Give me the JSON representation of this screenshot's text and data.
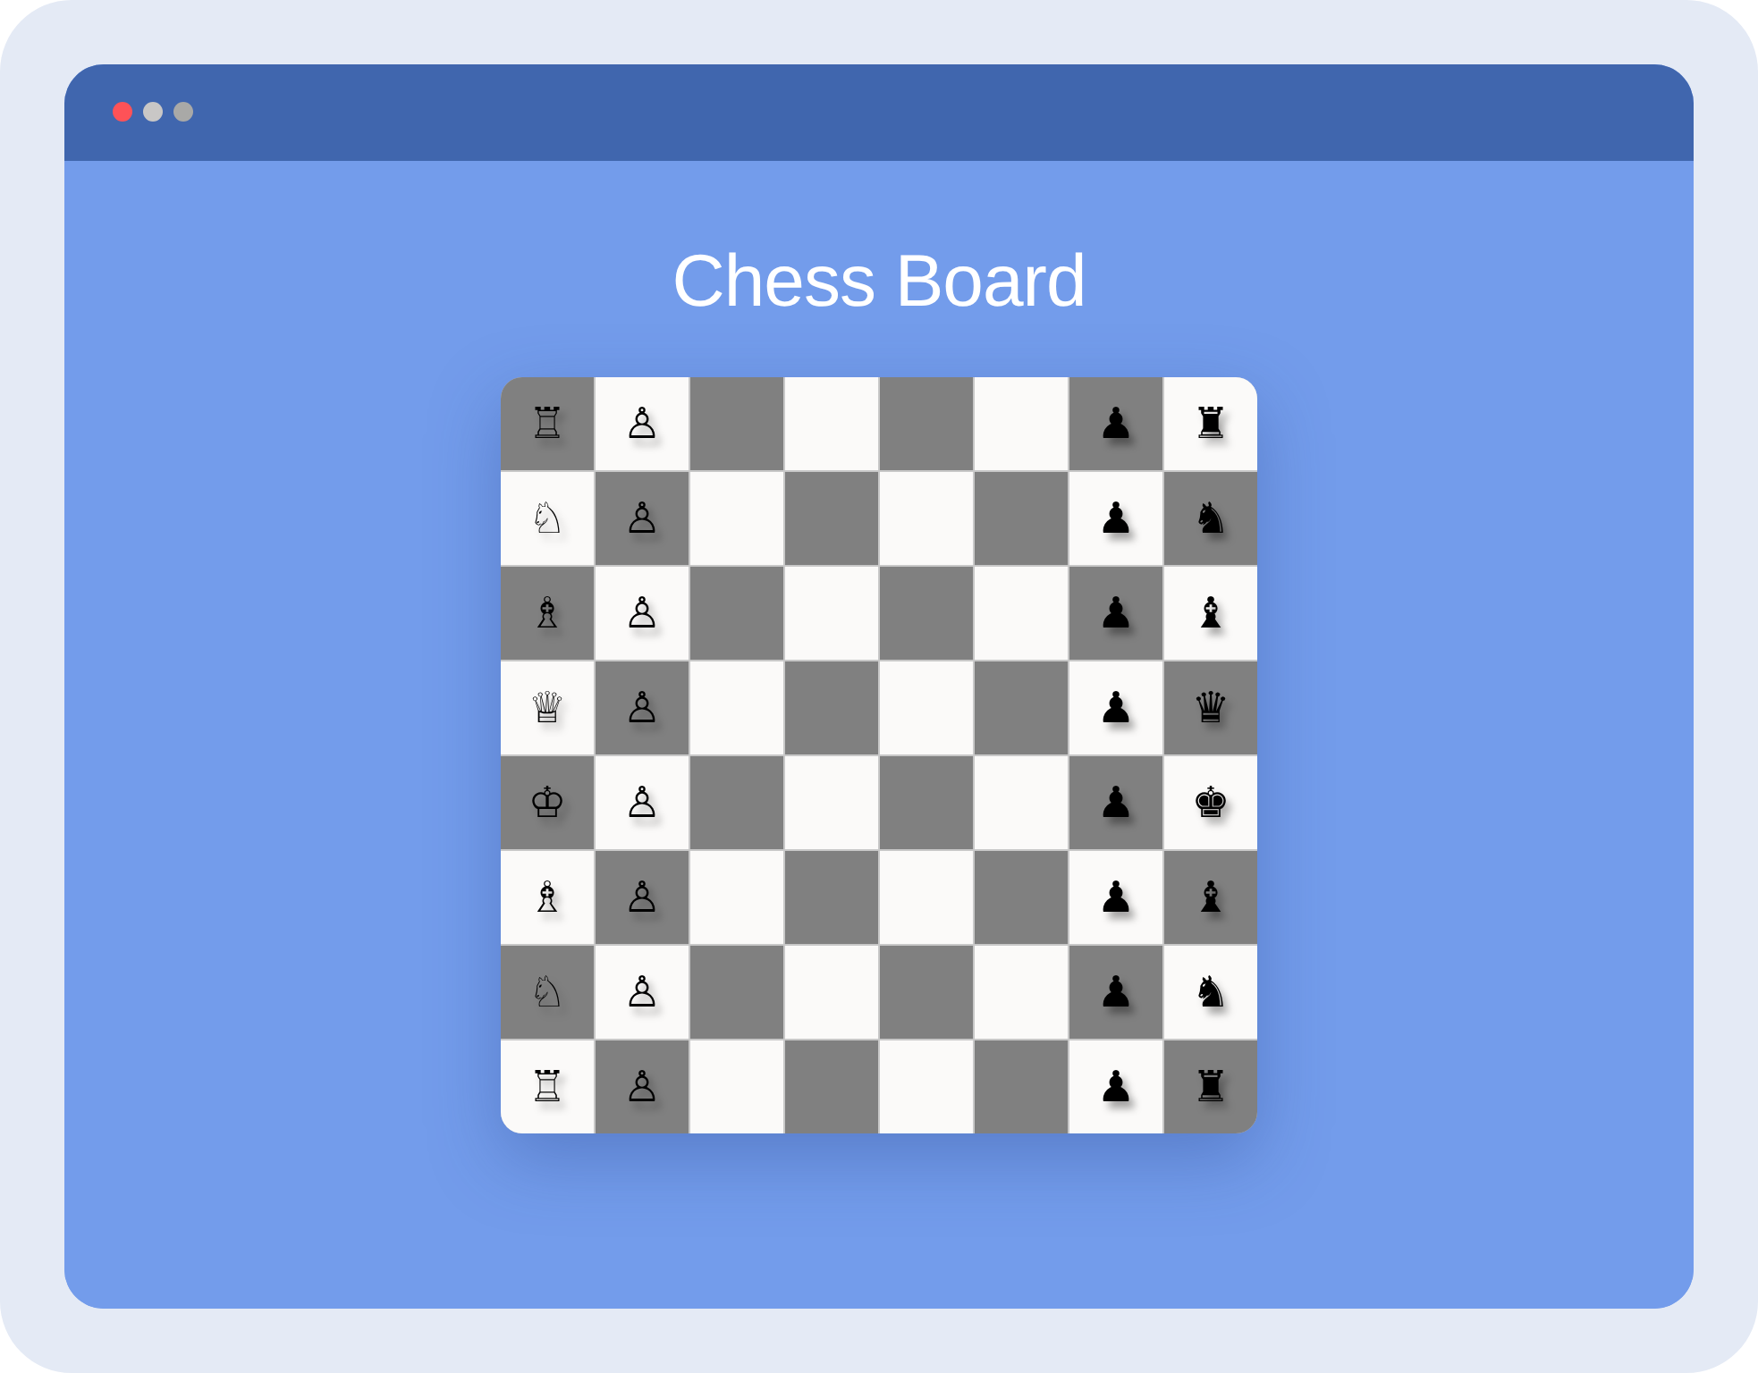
{
  "window": {
    "controls": [
      {
        "color": "#fe5257"
      },
      {
        "color": "#c9c7c6"
      },
      {
        "color": "#a9a9a7"
      }
    ]
  },
  "title": "Chess Board",
  "board": {
    "rows": [
      {
        "squares": [
          {
            "kind": "dark",
            "piece": "♖"
          },
          {
            "kind": "light",
            "piece": "♙"
          },
          {
            "kind": "dark"
          },
          {
            "kind": "light"
          },
          {
            "kind": "dark"
          },
          {
            "kind": "light"
          },
          {
            "kind": "dark",
            "piece": "♟"
          },
          {
            "kind": "light",
            "piece": "♜"
          }
        ]
      },
      {
        "squares": [
          {
            "kind": "light",
            "piece": "♘"
          },
          {
            "kind": "dark",
            "piece": "♙"
          },
          {
            "kind": "light"
          },
          {
            "kind": "dark"
          },
          {
            "kind": "light"
          },
          {
            "kind": "dark"
          },
          {
            "kind": "light",
            "piece": "♟"
          },
          {
            "kind": "dark",
            "piece": "♞"
          }
        ]
      },
      {
        "squares": [
          {
            "kind": "dark",
            "piece": "♗"
          },
          {
            "kind": "light",
            "piece": "♙"
          },
          {
            "kind": "dark"
          },
          {
            "kind": "light"
          },
          {
            "kind": "dark"
          },
          {
            "kind": "light"
          },
          {
            "kind": "dark",
            "piece": "♟"
          },
          {
            "kind": "light",
            "piece": "♝"
          }
        ]
      },
      {
        "squares": [
          {
            "kind": "light",
            "piece": "♕"
          },
          {
            "kind": "dark",
            "piece": "♙"
          },
          {
            "kind": "light"
          },
          {
            "kind": "dark"
          },
          {
            "kind": "light"
          },
          {
            "kind": "dark"
          },
          {
            "kind": "light",
            "piece": "♟"
          },
          {
            "kind": "dark",
            "piece": "♛"
          }
        ]
      },
      {
        "squares": [
          {
            "kind": "dark",
            "piece": "♔"
          },
          {
            "kind": "light",
            "piece": "♙"
          },
          {
            "kind": "dark"
          },
          {
            "kind": "light"
          },
          {
            "kind": "dark"
          },
          {
            "kind": "light"
          },
          {
            "kind": "dark",
            "piece": "♟"
          },
          {
            "kind": "light",
            "piece": "♚"
          }
        ]
      },
      {
        "squares": [
          {
            "kind": "light",
            "piece": "♗"
          },
          {
            "kind": "dark",
            "piece": "♙"
          },
          {
            "kind": "light"
          },
          {
            "kind": "dark"
          },
          {
            "kind": "light"
          },
          {
            "kind": "dark"
          },
          {
            "kind": "light",
            "piece": "♟"
          },
          {
            "kind": "dark",
            "piece": "♝"
          }
        ]
      },
      {
        "squares": [
          {
            "kind": "dark",
            "piece": "♘"
          },
          {
            "kind": "light",
            "piece": "♙"
          },
          {
            "kind": "dark"
          },
          {
            "kind": "light"
          },
          {
            "kind": "dark"
          },
          {
            "kind": "light"
          },
          {
            "kind": "dark",
            "piece": "♟"
          },
          {
            "kind": "light",
            "piece": "♞"
          }
        ]
      },
      {
        "squares": [
          {
            "kind": "light",
            "piece": "♖"
          },
          {
            "kind": "dark",
            "piece": "♙"
          },
          {
            "kind": "light"
          },
          {
            "kind": "dark"
          },
          {
            "kind": "light"
          },
          {
            "kind": "dark"
          },
          {
            "kind": "light",
            "piece": "♟"
          },
          {
            "kind": "dark",
            "piece": "♜"
          }
        ]
      }
    ]
  }
}
